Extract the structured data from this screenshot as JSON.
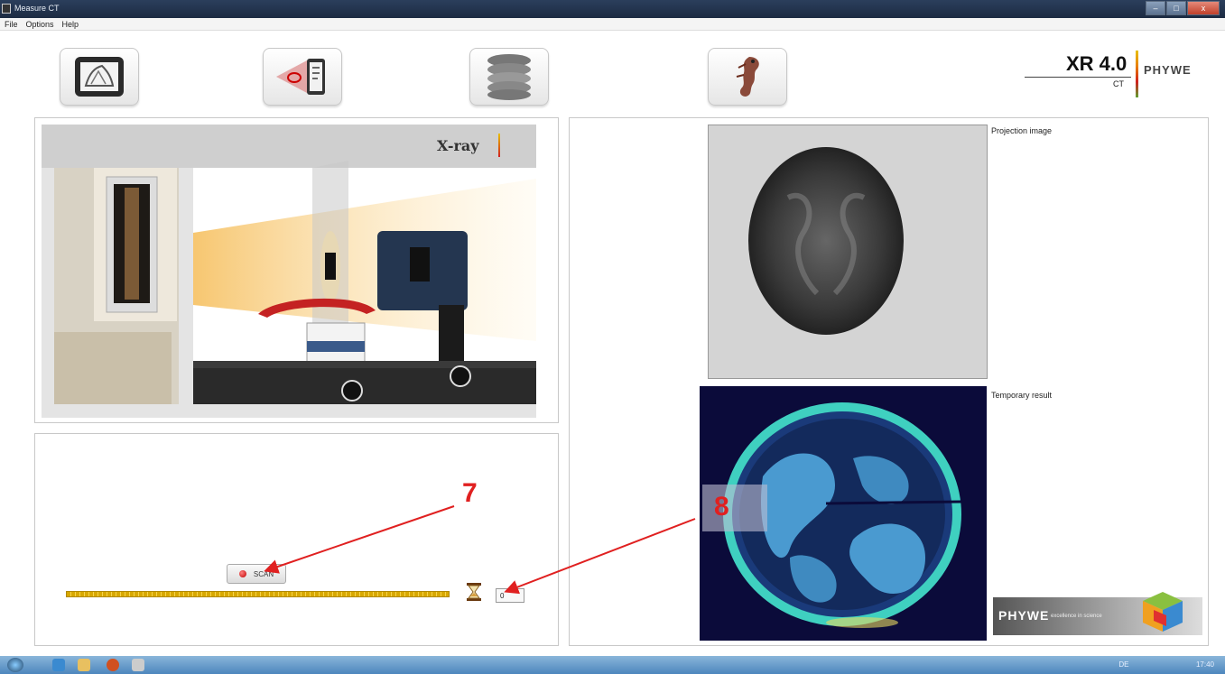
{
  "window": {
    "title": "Measure CT"
  },
  "menu": [
    "File",
    "Options",
    "Help"
  ],
  "toolbar": {
    "buttons": [
      {
        "name": "tablet-detector-icon"
      },
      {
        "name": "projection-setup-icon"
      },
      {
        "name": "slices-stack-icon"
      },
      {
        "name": "3d-seahorse-icon"
      }
    ]
  },
  "logo": {
    "version": "XR 4.0",
    "sub": "CT",
    "brand": "PHYWE"
  },
  "device_image": {
    "label": "X-ray"
  },
  "scan": {
    "button_label": "SCAN",
    "progress": 1.0,
    "counter_value": "0"
  },
  "images": {
    "projection_label": "Projection image",
    "result_label": "Temporary result"
  },
  "footer_logo": {
    "brand": "PHYWE",
    "tagline": "excellence in science"
  },
  "annotations": {
    "a7": "7",
    "a8": "8"
  },
  "taskbar": {
    "tray_text": "DE",
    "clock": "17:40"
  },
  "colors": {
    "accent_red": "#e02020",
    "progress_gold": "#f2c21a"
  }
}
